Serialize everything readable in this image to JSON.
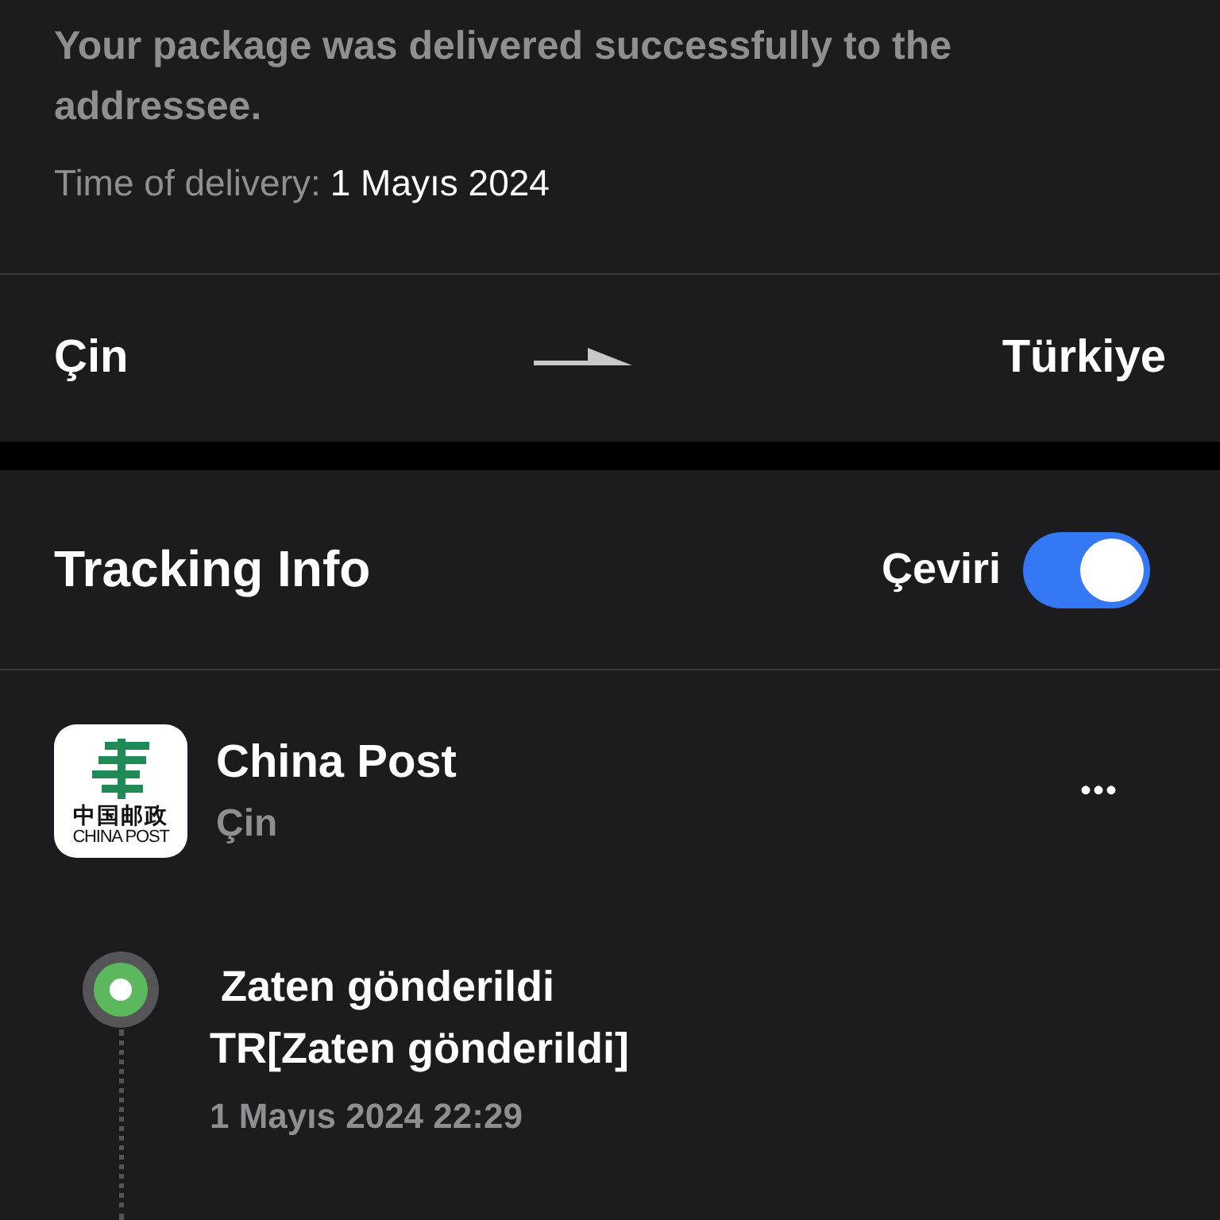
{
  "delivery": {
    "message": "Your package was delivered successfully to the addressee.",
    "time_label": "Time of delivery:",
    "time_value": "1 Mayıs 2024"
  },
  "route": {
    "origin": "Çin",
    "destination": "Türkiye"
  },
  "tracking": {
    "title": "Tracking Info",
    "translate_label": "Çeviri",
    "translate_on": true
  },
  "carrier": {
    "logo_text": "中国邮政",
    "logo_latin": "CHINA POST",
    "name": "China Post",
    "country": "Çin",
    "more": "•••"
  },
  "events": [
    {
      "status": "Zaten gönderildi",
      "detail": "TR[Zaten gönderildi]",
      "time": "1 Mayıs 2024 22:29"
    }
  ]
}
